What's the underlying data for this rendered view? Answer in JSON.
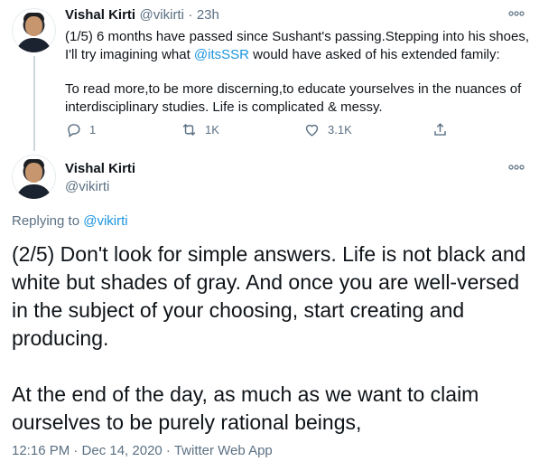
{
  "tweet1": {
    "author_name": "Vishal Kirti",
    "author_handle": "@vikirti",
    "separator": "·",
    "time": "23h",
    "text_line1": "(1/5) 6 months have passed since Sushant's passing.Stepping into his shoes,",
    "text_line2_before": "I'll try imagining what ",
    "text_line2_mention": "@itsSSR",
    "text_line2_after": " would have asked of his extended family:",
    "text_para2_line1": "To read more,to be more discerning,to educate yourselves in the nuances of",
    "text_para2_line2": "interdisciplinary studies. Life is complicated & messy.",
    "replies": "1",
    "retweets": "1K",
    "likes": "3.1K",
    "more_icon": "more-dots-icon"
  },
  "tweet2": {
    "author_name": "Vishal Kirti",
    "author_handle": "@vikirti",
    "replying_to_label": "Replying to",
    "replying_to_handle": "@vikirti",
    "line1": "(2/5) Don't look for simple answers. Life is not black and",
    "line2": "white but shades of gray. And once you are well-versed",
    "line3": "in the subject of your choosing, start creating and",
    "line4": "producing.",
    "line5": "At the end of the day, as much as we want to claim",
    "line6": "ourselves to be purely rational beings,",
    "timestamp": "12:16 PM · Dec 14, 2020 · Twitter Web App"
  },
  "colors": {
    "text": "#0f1419",
    "secondary": "#5b7083",
    "link": "#1b95e0",
    "thread_line": "#ccd6dd"
  }
}
